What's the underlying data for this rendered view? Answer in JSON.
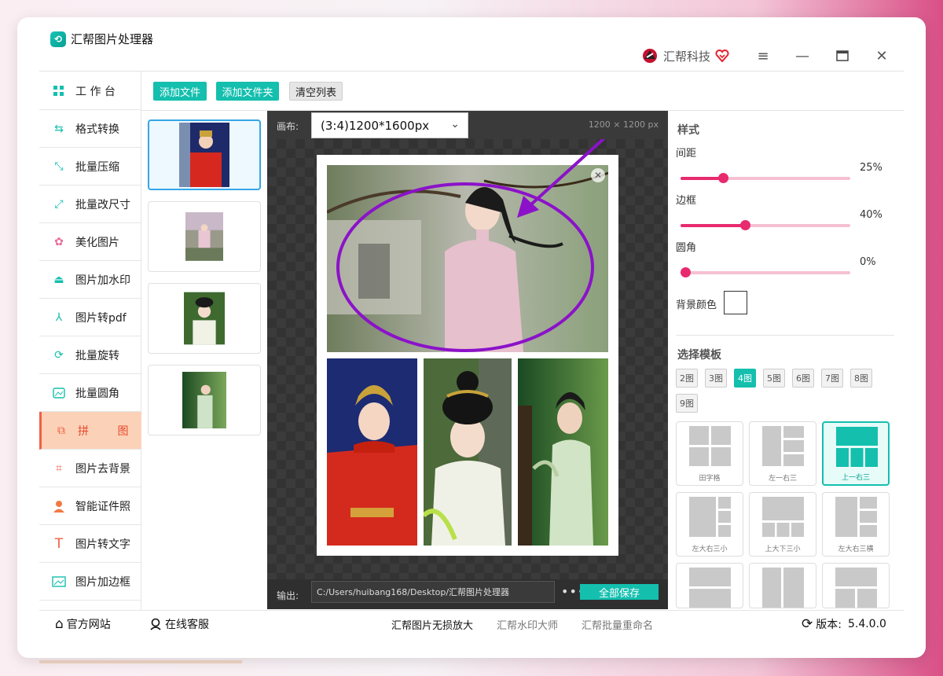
{
  "app": {
    "title": "汇帮图片处理器",
    "brand": "汇帮科技"
  },
  "toolbar": {
    "add_file": "添加文件",
    "add_folder": "添加文件夹",
    "clear_list": "清空列表"
  },
  "sidebar": {
    "items": [
      {
        "label": "工 作 台",
        "icon": "grid-icon"
      },
      {
        "label": "格式转换",
        "icon": "convert-icon"
      },
      {
        "label": "批量压缩",
        "icon": "compress-icon"
      },
      {
        "label": "批量改尺寸",
        "icon": "resize-icon"
      },
      {
        "label": "美化图片",
        "icon": "beautify-icon"
      },
      {
        "label": "图片加水印",
        "icon": "watermark-icon"
      },
      {
        "label": "图片转pdf",
        "icon": "pdf-icon"
      },
      {
        "label": "批量旋转",
        "icon": "rotate-icon"
      },
      {
        "label": "批量圆角",
        "icon": "round-corner-icon"
      },
      {
        "label": "拼 图",
        "icon": "puzzle-icon"
      },
      {
        "label": "图片去背景",
        "icon": "crop-icon"
      },
      {
        "label": "智能证件照",
        "icon": "person-icon"
      },
      {
        "label": "图片转文字",
        "icon": "text-icon"
      },
      {
        "label": "图片加边框",
        "icon": "frame-icon"
      }
    ],
    "active_index": 9
  },
  "canvas": {
    "label": "画布:",
    "selected": "(3:4)1200*1600px",
    "size_text": "1200 × 1200 px"
  },
  "output": {
    "label": "输出:",
    "path": "C:/Users/huibang168/Desktop/汇帮图片处理器",
    "more": "•••",
    "save_all": "全部保存"
  },
  "style_panel": {
    "title": "样式",
    "spacing": {
      "label": "间距",
      "value_text": "25%",
      "value": 0.25
    },
    "border": {
      "label": "边框",
      "value_text": "40%",
      "value": 0.4
    },
    "radius": {
      "label": "圆角",
      "value_text": "0%",
      "value": 0.0
    },
    "bg_color": {
      "label": "背景颜色",
      "color": "#ffffff"
    }
  },
  "template_panel": {
    "title": "选择模板",
    "counts": [
      "2图",
      "3图",
      "4图",
      "5图",
      "6图",
      "7图",
      "8图",
      "9图"
    ],
    "active_count": "4图",
    "templates": [
      {
        "name": "田字格",
        "active": false
      },
      {
        "name": "左一右三",
        "active": false
      },
      {
        "name": "上一右三",
        "active": true
      },
      {
        "name": "左大右三小",
        "active": false
      },
      {
        "name": "上大下三小",
        "active": false
      },
      {
        "name": "左大右三横",
        "active": false
      },
      {
        "name": "",
        "active": false
      },
      {
        "name": "",
        "active": false
      },
      {
        "name": "",
        "active": false
      }
    ]
  },
  "footer": {
    "website": "官方网站",
    "support": "在线客服",
    "links": [
      "汇帮图片无损放大",
      "汇帮水印大师",
      "汇帮批量重命名"
    ],
    "version_label": "版本:",
    "version": "5.4.0.0"
  },
  "colors": {
    "accent": "#14bfae",
    "active_bg": "#fbd2b7",
    "active_text": "#e8482e",
    "slider": "#e82a6e",
    "annotation": "#8b12c9"
  }
}
